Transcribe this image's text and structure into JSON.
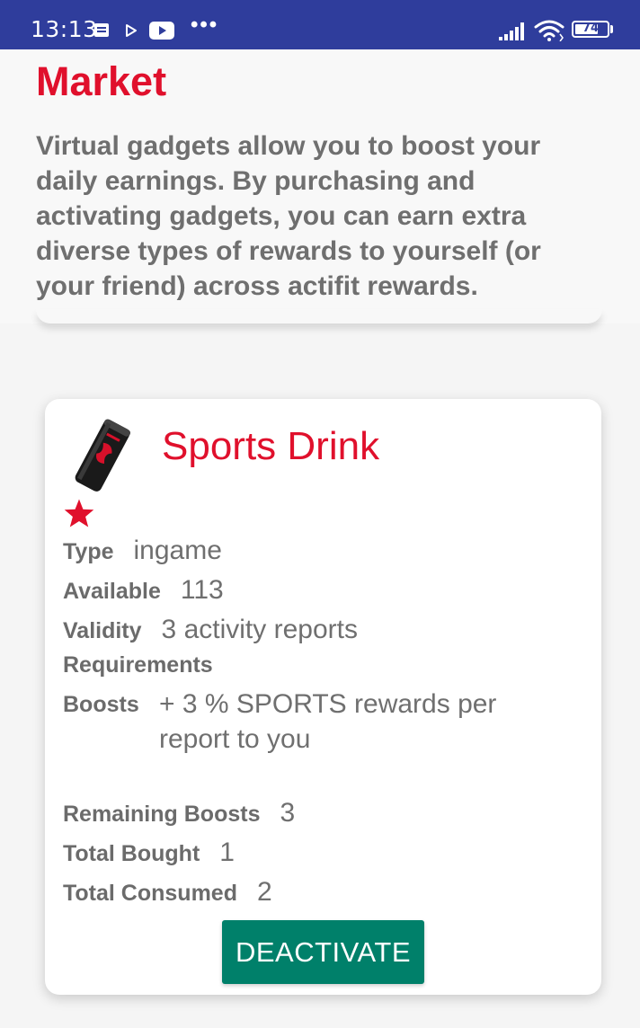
{
  "status_bar": {
    "time": "13:13",
    "battery": "74",
    "battery_level": 0.74,
    "icons": [
      "notification-icon",
      "play-icon",
      "youtube-icon",
      "more-icon",
      "signal-icon",
      "wifi-icon",
      "battery-icon"
    ],
    "dots": "•••"
  },
  "market": {
    "title": "Market",
    "description": "Virtual gadgets allow you to boost your daily earnings. By purchasing and activating gadgets, you can earn extra diverse types of rewards to yourself (or your friend) across actifit rewards."
  },
  "gadget": {
    "name": "Sports Drink",
    "type_label": "Type",
    "type_value": "ingame",
    "available_label": "Available",
    "available_value": "113",
    "validity_label": "Validity",
    "validity_value": "3 activity reports",
    "requirements_label": "Requirements",
    "boosts_label": "Boosts",
    "boosts_value": "+ 3 % SPORTS rewards per report to you",
    "remaining_boosts_label": "Remaining Boosts",
    "remaining_boosts_value": "3",
    "total_bought_label": "Total Bought",
    "total_bought_value": "1",
    "total_consumed_label": "Total Consumed",
    "total_consumed_value": "2",
    "deactivate_label": "DEACTIVATE"
  },
  "colors": {
    "status_bar": "#2f3d9c",
    "accent_red": "#e0102c",
    "button_green": "#00806a",
    "text_gray": "#6f6f6f"
  }
}
